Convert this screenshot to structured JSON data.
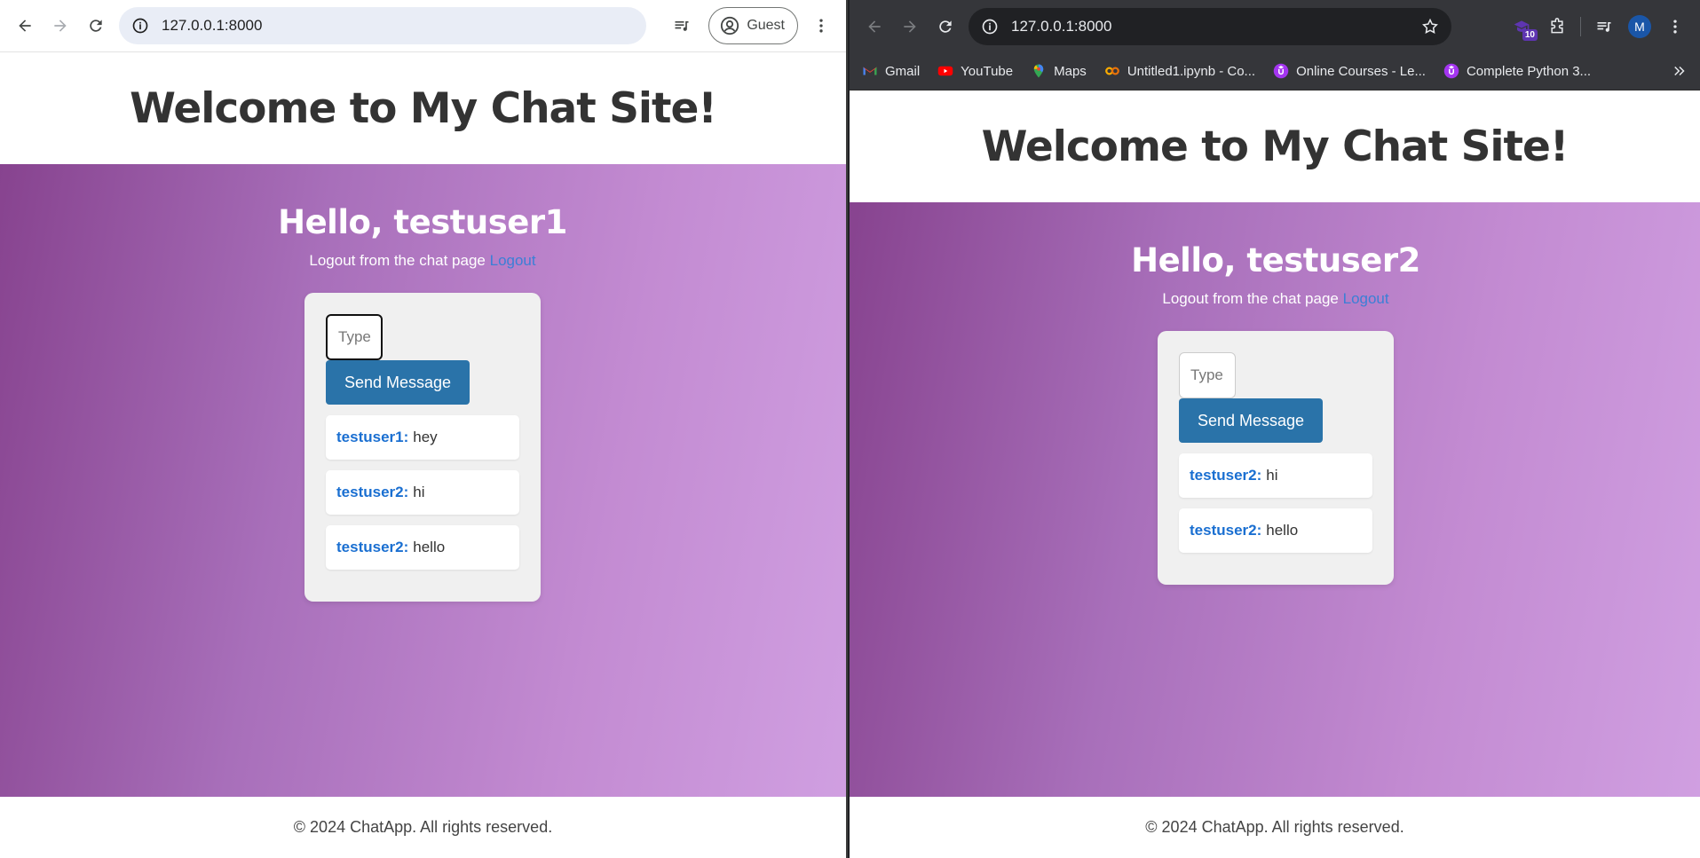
{
  "left_window": {
    "url": "127.0.0.1:8000",
    "profile_label": "Guest",
    "site_title": "Welcome to My Chat Site!",
    "greeting": "Hello, testuser1",
    "logout_text": "Logout from the chat page",
    "logout_link": "Logout",
    "input_placeholder": "Type",
    "send_label": "Send Message",
    "messages": [
      {
        "user": "testuser1:",
        "text": "hey"
      },
      {
        "user": "testuser2:",
        "text": "hi"
      },
      {
        "user": "testuser2:",
        "text": "hello"
      }
    ],
    "footer": "© 2024 ChatApp. All rights reserved."
  },
  "right_window": {
    "url": "127.0.0.1:8000",
    "extension_badge": "10",
    "avatar_letter": "M",
    "bookmarks": [
      {
        "label": "Gmail",
        "icon": "gmail-icon"
      },
      {
        "label": "YouTube",
        "icon": "youtube-icon"
      },
      {
        "label": "Maps",
        "icon": "maps-icon"
      },
      {
        "label": "Untitled1.ipynb - Co...",
        "icon": "colab-icon"
      },
      {
        "label": "Online Courses - Le...",
        "icon": "udemy-icon"
      },
      {
        "label": "Complete Python 3...",
        "icon": "udemy-icon"
      }
    ],
    "site_title": "Welcome to My Chat Site!",
    "greeting": "Hello, testuser2",
    "logout_text": "Logout from the chat page",
    "logout_link": "Logout",
    "input_placeholder": "Type",
    "send_label": "Send Message",
    "messages": [
      {
        "user": "testuser2:",
        "text": "hi"
      },
      {
        "user": "testuser2:",
        "text": "hello"
      }
    ],
    "footer": "© 2024 ChatApp. All rights reserved."
  },
  "colors": {
    "gradient_start": "#87438f",
    "gradient_end": "#d09fe1",
    "button": "#2a73a9",
    "username": "#1a6fd1",
    "link": "#3b7fd6"
  }
}
